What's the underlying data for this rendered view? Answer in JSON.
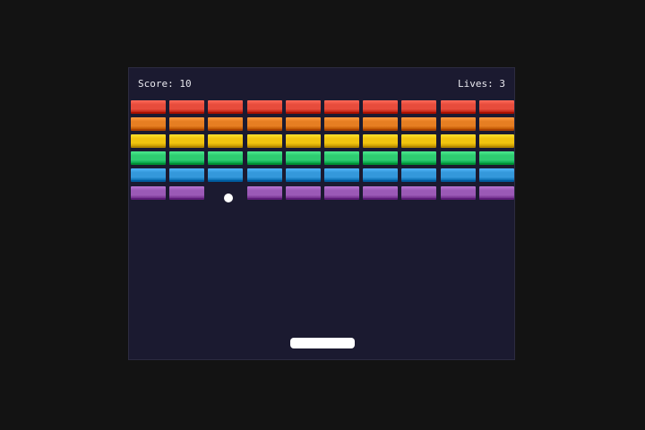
{
  "hud": {
    "score_label": "Score:",
    "score_value": "10",
    "lives_label": "Lives:",
    "lives_value": "3"
  },
  "colors": {
    "page_background": "#131313",
    "board_background": "#1b1a30",
    "ball": "#ffffff",
    "paddle": "#ffffff",
    "hud_text": "#e8e8ee"
  },
  "bricks": {
    "columns": 10,
    "rows": [
      {
        "name": "red",
        "color": "#e74c3c",
        "present": [
          1,
          1,
          1,
          1,
          1,
          1,
          1,
          1,
          1,
          1
        ]
      },
      {
        "name": "orange",
        "color": "#e67e22",
        "present": [
          1,
          1,
          1,
          1,
          1,
          1,
          1,
          1,
          1,
          1
        ]
      },
      {
        "name": "yellow",
        "color": "#f1c40f",
        "present": [
          1,
          1,
          1,
          1,
          1,
          1,
          1,
          1,
          1,
          1
        ]
      },
      {
        "name": "green",
        "color": "#2ecc71",
        "present": [
          1,
          1,
          1,
          1,
          1,
          1,
          1,
          1,
          1,
          1
        ]
      },
      {
        "name": "blue",
        "color": "#3498db",
        "present": [
          1,
          1,
          1,
          1,
          1,
          1,
          1,
          1,
          1,
          1
        ]
      },
      {
        "name": "purple",
        "color": "#9b59b6",
        "present": [
          1,
          1,
          0,
          1,
          1,
          1,
          1,
          1,
          1,
          1
        ]
      }
    ]
  }
}
